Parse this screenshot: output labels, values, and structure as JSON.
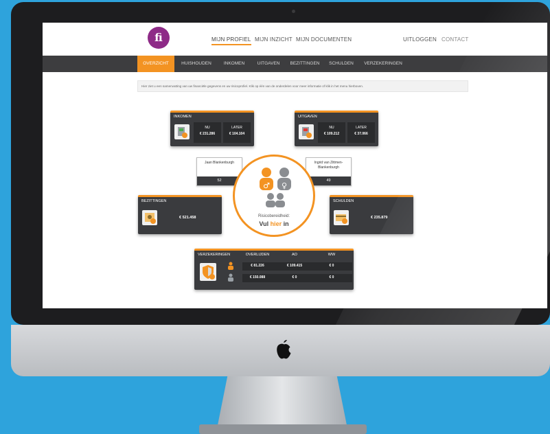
{
  "topnav": {
    "items": [
      "MIJN PROFIEL",
      "MIJN INZICHT",
      "MIJN DOCUMENTEN"
    ],
    "logout": "UITLOGGEN",
    "contact": "CONTACT",
    "logo_text": "fi"
  },
  "subnav": {
    "items": [
      "OVERZICHT",
      "HUISHOUDEN",
      "INKOMEN",
      "UITGAVEN",
      "BEZITTINGEN",
      "SCHULDEN",
      "VERZEKERINGEN"
    ]
  },
  "info_text": "Hier ziet u een samenvatting van uw financiële gegevens en uw risicoprofiel. Klik op één van de onderdelen voor meer informatie of klik in het menu hierboven.",
  "inkomen": {
    "title": "INKOMEN",
    "nu_label": "NU",
    "nu_value": "€ 231.286",
    "later_label": "LATER",
    "later_value": "€ 104.104"
  },
  "uitgaven": {
    "title": "UITGAVEN",
    "nu_label": "NU",
    "nu_value": "€ 109.212",
    "later_label": "LATER",
    "later_value": "€ 37.066"
  },
  "person_left": {
    "name": "Jaan Blankenburgh",
    "age": "52"
  },
  "person_right": {
    "name": "Ingrid van Zittmen-Blankenburgh",
    "age": "49"
  },
  "bezittingen": {
    "title": "BEZITTINGEN",
    "value": "€ 521.458"
  },
  "schulden": {
    "title": "SCHULDEN",
    "value": "€ 235.879"
  },
  "risk": {
    "label": "Risicobereidheid:",
    "cta_prefix": "Vul ",
    "cta_highlight": "hier",
    "cta_suffix": " in"
  },
  "verzekeringen": {
    "title": "VERZEKERINGEN",
    "columns": [
      "OVERLIJDEN",
      "AO",
      "WW"
    ],
    "rows": [
      [
        "€ 81.226",
        "€ 109.415",
        "€ 0"
      ],
      [
        "€ 150.088",
        "€ 0",
        "€ 0"
      ]
    ]
  },
  "colors": {
    "accent": "#f39322",
    "panel": "#3a3b3e",
    "brand": "#8e2b87",
    "background": "#2ea3dc"
  }
}
